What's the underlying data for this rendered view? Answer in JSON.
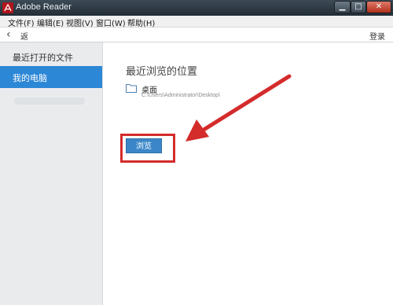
{
  "window": {
    "title": "Adobe Reader"
  },
  "menu": [
    "文件(F)",
    "编辑(E)",
    "视图(V)",
    "窗口(W)",
    "帮助(H)"
  ],
  "toolbar": {
    "back_label": "返回",
    "login_label": "登录"
  },
  "sidebar": {
    "items": [
      {
        "label": "最近打开的文件"
      },
      {
        "label": "我的电脑",
        "selected": true
      }
    ]
  },
  "main": {
    "section_title": "最近浏览的位置",
    "recent_location": {
      "name": "桌面",
      "path": "C:\\Users\\Administrator\\Desktop\\"
    },
    "browse_button_label": "浏览"
  },
  "colors": {
    "accent": "#2c87d6",
    "highlight": "#d42b2b"
  }
}
